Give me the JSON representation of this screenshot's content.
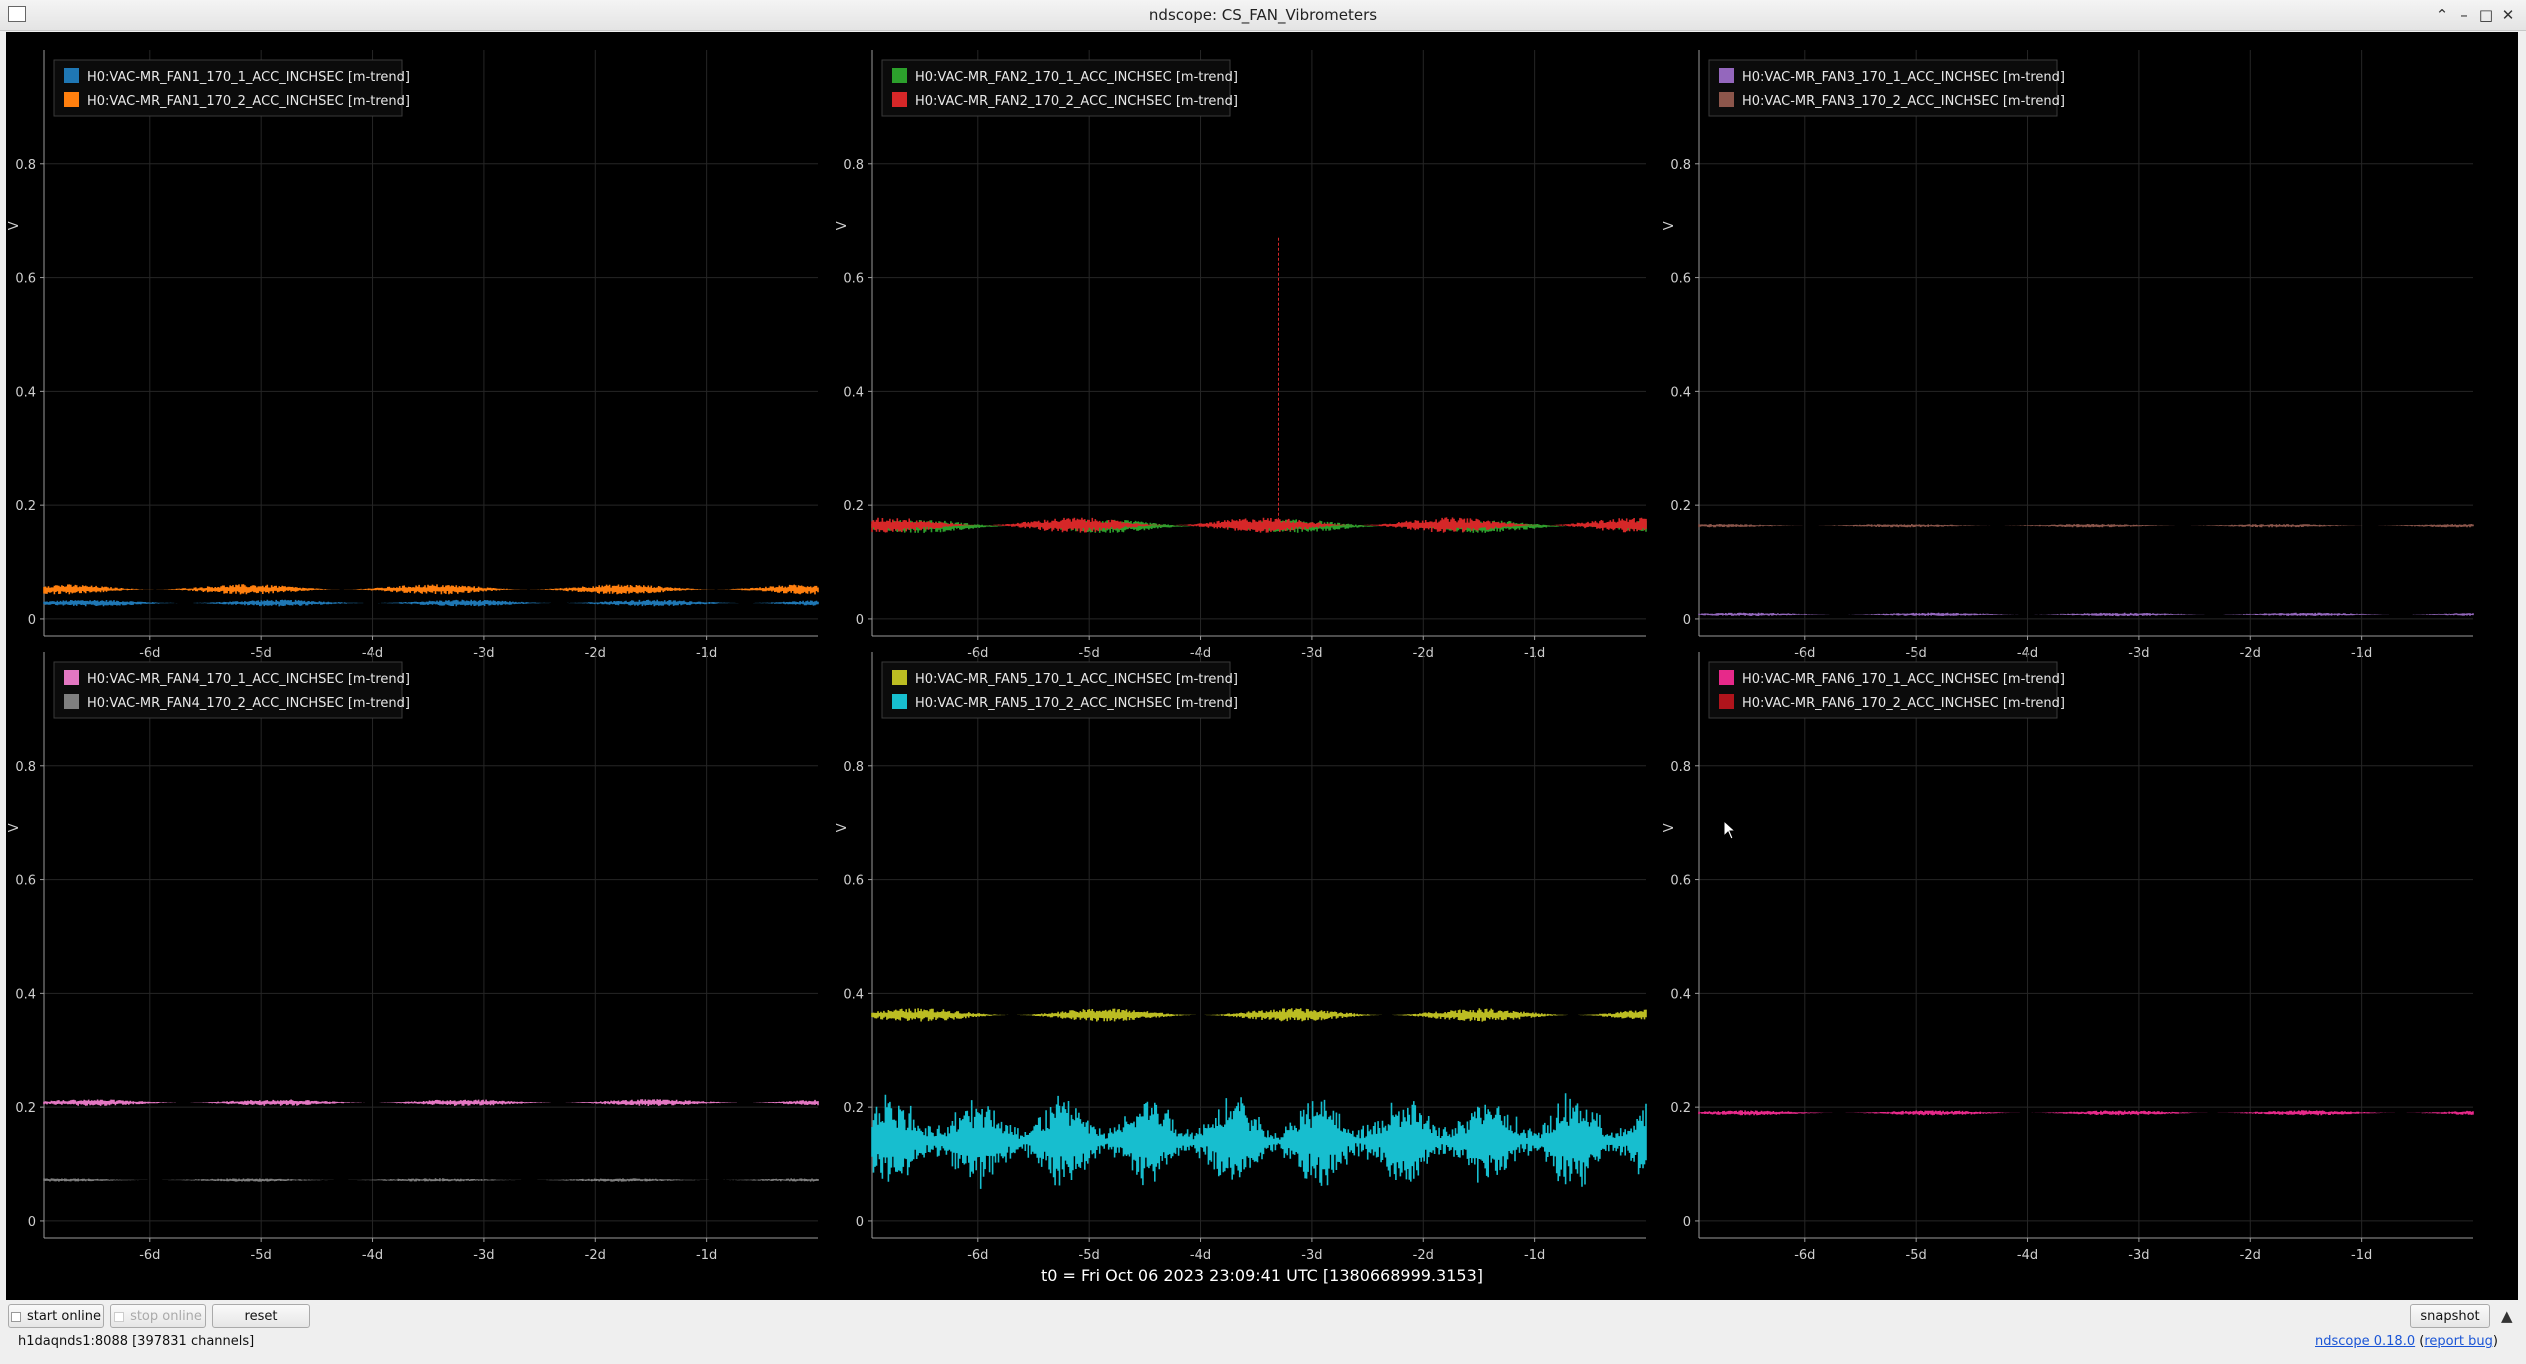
{
  "window": {
    "title": "ndscope: CS_FAN_Vibrometers",
    "controls": {
      "up": "⌃",
      "minimize": "–",
      "maximize": "□",
      "close": "✕"
    }
  },
  "axes": {
    "ylabel": "V",
    "y_ticks": [
      "0",
      "0.2",
      "0.4",
      "0.6",
      "0.8"
    ],
    "x_ticks": [
      "-6d",
      "-5d",
      "-4d",
      "-3d",
      "-2d",
      "-1d"
    ]
  },
  "chart_data": [
    {
      "type": "line",
      "ylabel": "V",
      "ylim": [
        0,
        1
      ],
      "grid": true,
      "legend": "top-left",
      "series": [
        {
          "name": "H0:VAC-MR_FAN1_170_1_ACC_INCHSEC [m-trend]",
          "color": "#1f77b4",
          "level": 0.028,
          "noise": 0.004
        },
        {
          "name": "H0:VAC-MR_FAN1_170_2_ACC_INCHSEC [m-trend]",
          "color": "#ff7f0e",
          "level": 0.052,
          "noise": 0.006
        }
      ]
    },
    {
      "type": "line",
      "ylabel": "V",
      "ylim": [
        0,
        1
      ],
      "grid": true,
      "legend": "top-left",
      "series": [
        {
          "name": "H0:VAC-MR_FAN2_170_1_ACC_INCHSEC [m-trend]",
          "color": "#2ca02c",
          "level": 0.163,
          "noise": 0.008
        },
        {
          "name": "H0:VAC-MR_FAN2_170_2_ACC_INCHSEC [m-trend]",
          "color": "#d62728",
          "level": 0.165,
          "noise": 0.009
        }
      ],
      "annotations": [
        {
          "type": "spike",
          "x": "-3.3d",
          "y": 0.67
        }
      ]
    },
    {
      "type": "line",
      "ylabel": "V",
      "ylim": [
        0,
        1
      ],
      "grid": true,
      "legend": "top-left",
      "series": [
        {
          "name": "H0:VAC-MR_FAN3_170_1_ACC_INCHSEC [m-trend]",
          "color": "#9467bd",
          "level": 0.008,
          "noise": 0.002
        },
        {
          "name": "H0:VAC-MR_FAN3_170_2_ACC_INCHSEC [m-trend]",
          "color": "#8c564b",
          "level": 0.164,
          "noise": 0.002
        }
      ]
    },
    {
      "type": "line",
      "ylabel": "V",
      "ylim": [
        0,
        1
      ],
      "grid": true,
      "legend": "top-left",
      "series": [
        {
          "name": "H0:VAC-MR_FAN4_170_1_ACC_INCHSEC [m-trend]",
          "color": "#e377c2",
          "level": 0.208,
          "noise": 0.004
        },
        {
          "name": "H0:VAC-MR_FAN4_170_2_ACC_INCHSEC [m-trend]",
          "color": "#7f7f7f",
          "level": 0.072,
          "noise": 0.002
        }
      ]
    },
    {
      "type": "line",
      "ylabel": "V",
      "ylim": [
        0,
        1
      ],
      "grid": true,
      "legend": "top-left",
      "series": [
        {
          "name": "H0:VAC-MR_FAN5_170_1_ACC_INCHSEC [m-trend]",
          "color": "#bcbd22",
          "level": 0.362,
          "noise": 0.008
        },
        {
          "name": "H0:VAC-MR_FAN5_170_2_ACC_INCHSEC [m-trend]",
          "color": "#17becf",
          "level": 0.14,
          "noise": 0.04
        }
      ]
    },
    {
      "type": "line",
      "ylabel": "V",
      "ylim": [
        0,
        1
      ],
      "grid": true,
      "legend": "top-left",
      "series": [
        {
          "name": "H0:VAC-MR_FAN6_170_1_ACC_INCHSEC [m-trend]",
          "color": "#e7298a",
          "level": 0.19,
          "noise": 0.003
        },
        {
          "name": "H0:VAC-MR_FAN6_170_2_ACC_INCHSEC [m-trend]",
          "color": "#b0141c",
          "level": 0.002,
          "noise": 0.0
        }
      ]
    }
  ],
  "t0_label": "t0 = Fri Oct 06 2023 23:09:41 UTC [1380668999.3153]",
  "toolbar": {
    "start_online": "start online",
    "stop_online": "stop online",
    "reset": "reset",
    "snapshot": "snapshot"
  },
  "status": {
    "server": "h1daqnds1:8088  [397831 channels]",
    "version": "ndscope 0.18.0",
    "report_bug": "report bug"
  }
}
